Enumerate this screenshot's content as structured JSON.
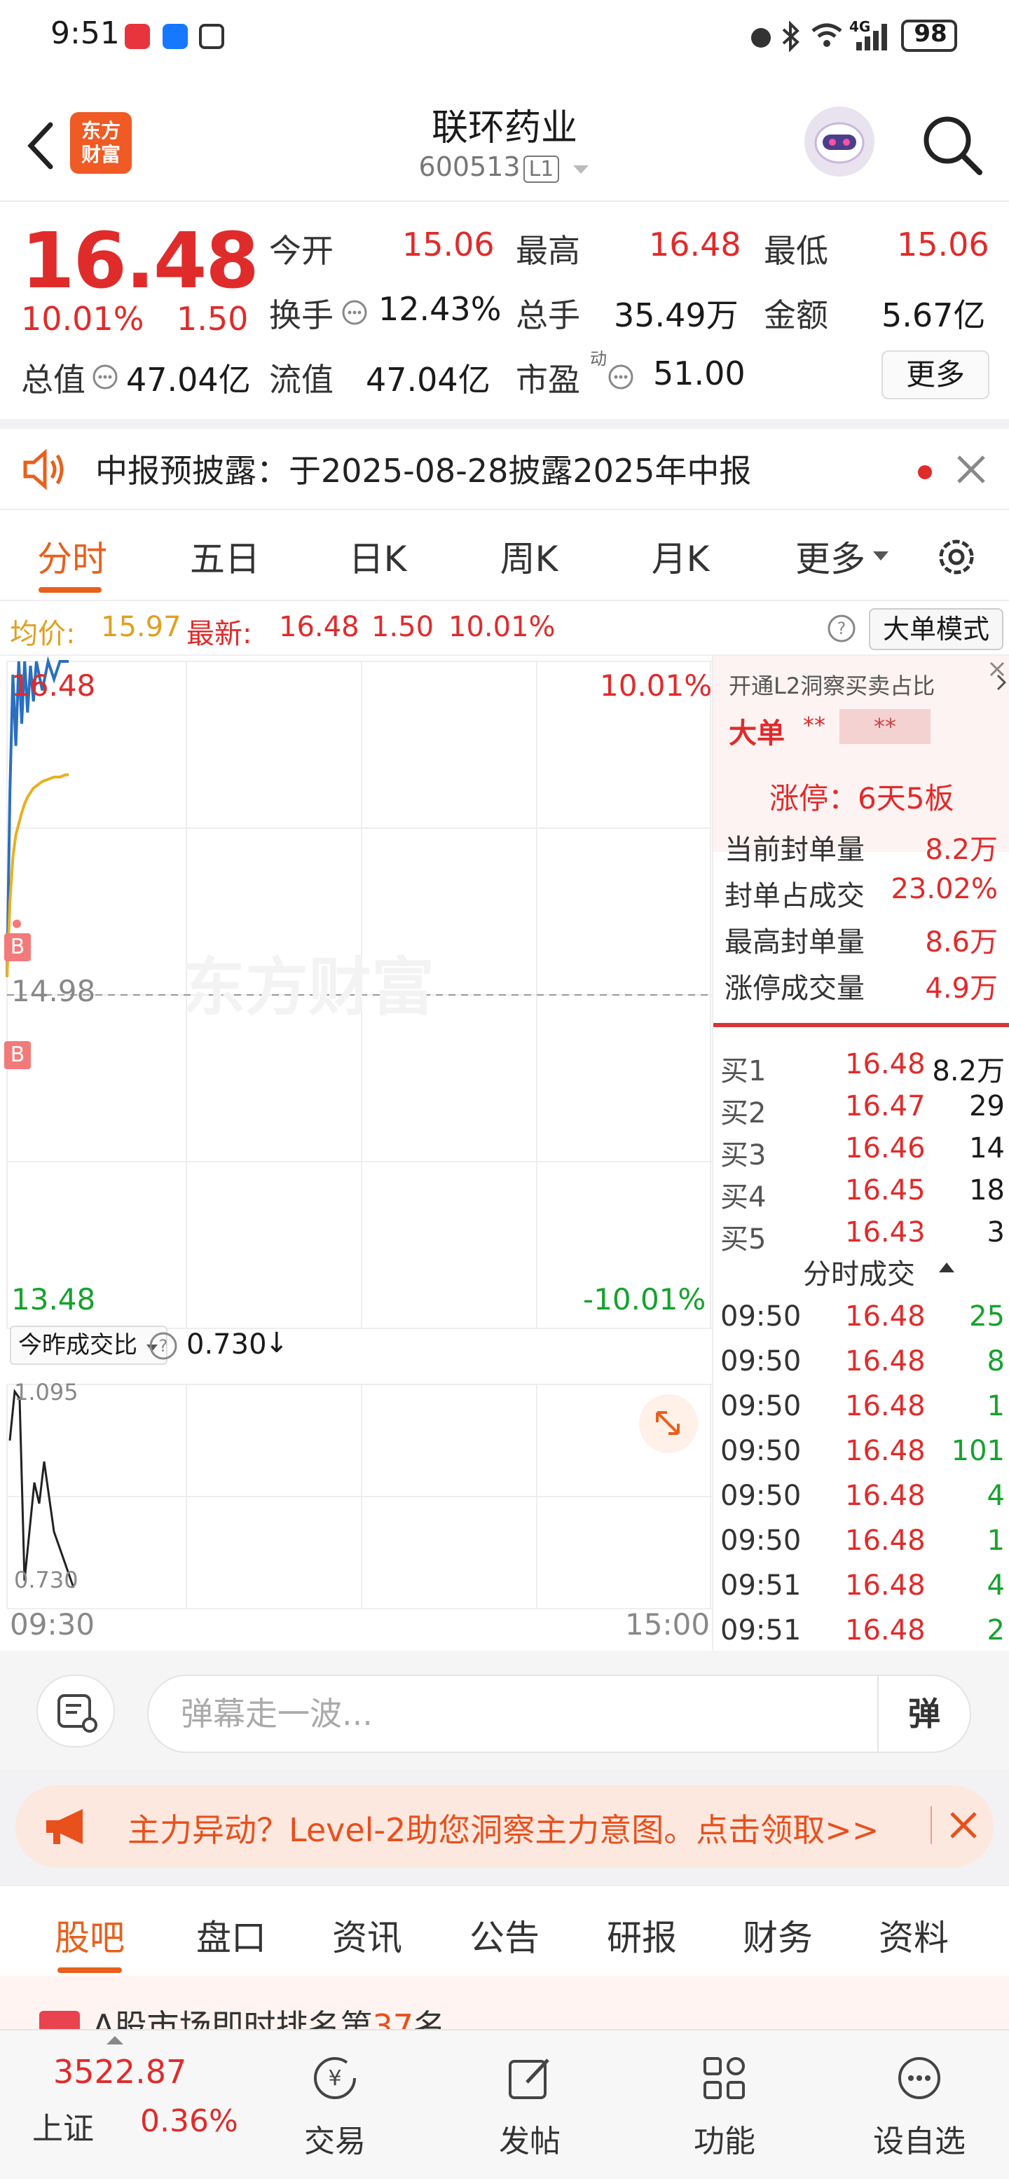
{
  "status_bar": {
    "time": "9:51",
    "network": "4G",
    "battery": "98"
  },
  "header": {
    "logo_text_1": "东方",
    "logo_text_2": "财富",
    "title": "联环药业",
    "code": "600513",
    "level": "L1"
  },
  "quote": {
    "price": "16.48",
    "pct": "10.01%",
    "change": "1.50",
    "open_label": "今开",
    "open": "15.06",
    "high_label": "最高",
    "high": "16.48",
    "low_label": "最低",
    "low": "15.06",
    "turnover_label": "换手",
    "turnover": "12.43%",
    "volume_label": "总手",
    "volume": "35.49万",
    "amount_label": "金额",
    "amount": "5.67亿",
    "mcap_label": "总值",
    "mcap": "47.04亿",
    "float_label": "流值",
    "float": "47.04亿",
    "pe_label": "市盈",
    "pe_sup": "动",
    "pe": "51.00",
    "more": "更多"
  },
  "notice": {
    "text": "中报预披露：于2025-08-28披露2025年中报"
  },
  "tabs": [
    "分时",
    "五日",
    "日K",
    "周K",
    "月K",
    "更多"
  ],
  "info_row": {
    "avg_label": "均价:",
    "avg": "15.97",
    "latest_label": "最新:",
    "latest": "16.48",
    "latest_chg": "1.50",
    "latest_pct": "10.01%",
    "big_mode": "大单模式"
  },
  "chart": {
    "top_price": "16.48",
    "top_pct": "10.01%",
    "mid_price": "14.98",
    "bottom_price": "13.48",
    "bottom_pct": "-10.01%",
    "watermark": "东方财富",
    "marker_b": "B",
    "ratio_label": "今昨成交比",
    "ratio_value": "0.730",
    "ratio_arrow": "↓",
    "sub_top": "1.095",
    "sub_bottom": "0.730",
    "time_start": "09:30",
    "time_end": "15:00"
  },
  "chart_data": {
    "type": "line",
    "x": [
      "09:30",
      "09:31",
      "09:32",
      "09:33",
      "09:34",
      "09:35",
      "09:36",
      "09:37",
      "09:38",
      "09:39",
      "09:40",
      "09:42",
      "09:44",
      "09:46",
      "09:48",
      "09:50",
      "09:51"
    ],
    "series": [
      {
        "name": "",
        "values": [
          15.06,
          15.9,
          16.42,
          16.1,
          16.48,
          16.2,
          16.48,
          16.25,
          16.46,
          16.3,
          16.48,
          16.35,
          16.48,
          16.4,
          16.48,
          16.48,
          16.48
        ]
      },
      {
        "name": "均价",
        "values": [
          15.06,
          15.4,
          15.6,
          15.7,
          15.75,
          15.8,
          15.84,
          15.87,
          15.89,
          15.91,
          15.92,
          15.94,
          15.95,
          15.96,
          15.96,
          15.97,
          15.97
        ]
      }
    ],
    "ylim": [
      13.48,
      16.48
    ],
    "title": "",
    "xlabel": "",
    "ylabel": ""
  },
  "right_panel": {
    "l2_text": "开通L2洞察买卖占比",
    "big_label": "大单",
    "big_masked_1": "**",
    "big_masked_2": "**",
    "limit_up": "涨停：6天5板",
    "stats": [
      {
        "label": "当前封单量",
        "value": "8.2万"
      },
      {
        "label": "封单占成交",
        "value": "23.02%"
      },
      {
        "label": "最高封单量",
        "value": "8.6万"
      },
      {
        "label": "涨停成交量",
        "value": "4.9万"
      }
    ],
    "bids": [
      {
        "label": "买1",
        "price": "16.48",
        "vol": "8.2万"
      },
      {
        "label": "买2",
        "price": "16.47",
        "vol": "29"
      },
      {
        "label": "买3",
        "price": "16.46",
        "vol": "14"
      },
      {
        "label": "买4",
        "price": "16.45",
        "vol": "18"
      },
      {
        "label": "买5",
        "price": "16.43",
        "vol": "3"
      }
    ],
    "trades_header": "分时成交",
    "trades": [
      {
        "time": "09:50",
        "price": "16.48",
        "vol": "25"
      },
      {
        "time": "09:50",
        "price": "16.48",
        "vol": "8"
      },
      {
        "time": "09:50",
        "price": "16.48",
        "vol": "1"
      },
      {
        "time": "09:50",
        "price": "16.48",
        "vol": "101"
      },
      {
        "time": "09:50",
        "price": "16.48",
        "vol": "4"
      },
      {
        "time": "09:50",
        "price": "16.48",
        "vol": "1"
      },
      {
        "time": "09:51",
        "price": "16.48",
        "vol": "4"
      },
      {
        "time": "09:51",
        "price": "16.48",
        "vol": "2"
      }
    ]
  },
  "danmu": {
    "placeholder": "弹幕走一波...",
    "send": "弹"
  },
  "promo": {
    "text": "主力异动？Level-2助您洞察主力意图。点击领取>>"
  },
  "bottom_tabs": [
    "股吧",
    "盘口",
    "资讯",
    "公告",
    "研报",
    "财务",
    "资料"
  ],
  "peek": {
    "text_a": "A股市场即时排名第",
    "text_num": "37",
    "text_b": "名"
  },
  "bottom_nav": {
    "index_value": "3522.87",
    "index_name": "上证",
    "index_pct": "0.36%",
    "items": [
      "交易",
      "发帖",
      "功能",
      "设自选"
    ]
  }
}
